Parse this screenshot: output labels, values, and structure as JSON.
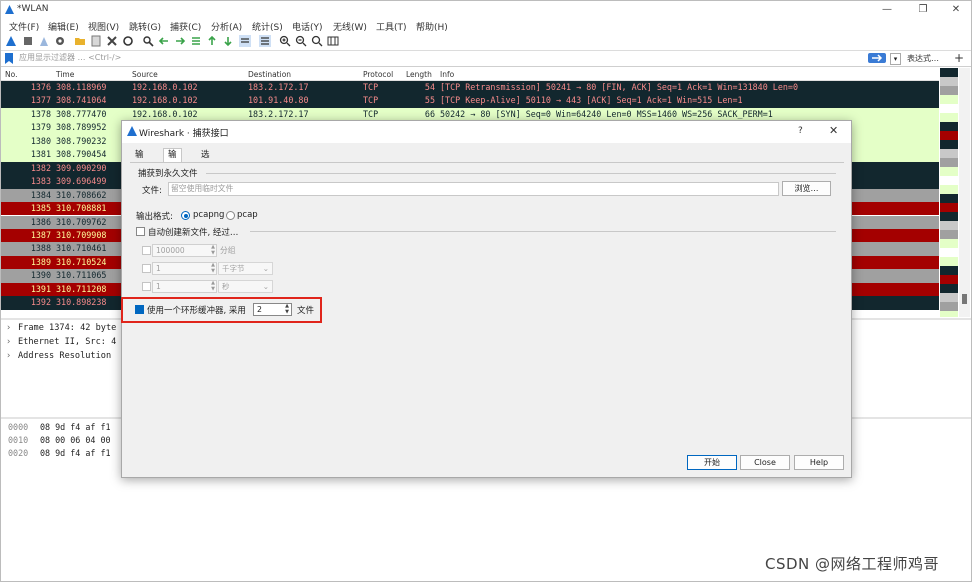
{
  "window": {
    "title": "*WLAN"
  },
  "menu": [
    "文件(F)",
    "编辑(E)",
    "视图(V)",
    "跳转(G)",
    "捕获(C)",
    "分析(A)",
    "统计(S)",
    "电话(Y)",
    "无线(W)",
    "工具(T)",
    "帮助(H)"
  ],
  "filter": {
    "placeholder": "应用显示过滤器 … <Ctrl-/>",
    "expression_label": "表达式…",
    "add_label": "+"
  },
  "packet_list": {
    "columns": [
      "No.",
      "Time",
      "Source",
      "Destination",
      "Protocol",
      "Length",
      "Info"
    ],
    "rows": [
      {
        "no": "1376",
        "time": "308.118969",
        "src": "192.168.0.102",
        "dst": "183.2.172.17",
        "proto": "TCP",
        "len": "54",
        "info": "[TCP Retransmission] 50241 → 80 [FIN, ACK] Seq=1 Ack=1 Win=131840 Len=0",
        "bg": "#12272e",
        "fg": "#f78b8b"
      },
      {
        "no": "1377",
        "time": "308.741064",
        "src": "192.168.0.102",
        "dst": "101.91.40.80",
        "proto": "TCP",
        "len": "55",
        "info": "[TCP Keep-Alive] 50110 → 443 [ACK] Seq=1 Ack=1 Win=515 Len=1",
        "bg": "#12272e",
        "fg": "#f78b8b"
      },
      {
        "no": "1378",
        "time": "308.777470",
        "src": "192.168.0.102",
        "dst": "183.2.172.17",
        "proto": "TCP",
        "len": "66",
        "info": "50242 → 80 [SYN] Seq=0 Win=64240 Len=0 MSS=1460 WS=256 SACK_PERM=1",
        "bg": "#e4ffc7",
        "fg": "#12272e"
      },
      {
        "no": "1379",
        "time": "308.789952",
        "src": "",
        "dst": "",
        "proto": "",
        "len": "",
        "info": "",
        "bg": "#e4ffc7",
        "fg": "#12272e"
      },
      {
        "no": "1380",
        "time": "308.790232",
        "src": "",
        "dst": "",
        "proto": "",
        "len": "",
        "info": "",
        "bg": "#e4ffc7",
        "fg": "#12272e"
      },
      {
        "no": "1381",
        "time": "308.790454",
        "src": "",
        "dst": "",
        "proto": "",
        "len": "",
        "info": "",
        "bg": "#e4ffc7",
        "fg": "#12272e"
      },
      {
        "no": "1382",
        "time": "309.090290",
        "src": "",
        "dst": "",
        "proto": "",
        "len": "",
        "info": "",
        "bg": "#12272e",
        "fg": "#f78b8b"
      },
      {
        "no": "1383",
        "time": "309.696499",
        "src": "",
        "dst": "",
        "proto": "",
        "len": "",
        "info": "",
        "bg": "#12272e",
        "fg": "#f78b8b"
      },
      {
        "no": "1384",
        "time": "310.708662",
        "src": "",
        "dst": "",
        "proto": "",
        "len": "",
        "info": "",
        "bg": "#a0a0a0",
        "fg": "#12272e"
      },
      {
        "no": "1385",
        "time": "310.708881",
        "src": "",
        "dst": "",
        "proto": "",
        "len": "",
        "info": "",
        "bg": "#a40000",
        "fg": "#fffc9c"
      },
      {
        "no": "1386",
        "time": "310.709762",
        "src": "",
        "dst": "",
        "proto": "",
        "len": "",
        "info": "",
        "bg": "#a0a0a0",
        "fg": "#12272e"
      },
      {
        "no": "1387",
        "time": "310.709908",
        "src": "",
        "dst": "",
        "proto": "",
        "len": "",
        "info": "",
        "bg": "#a40000",
        "fg": "#fffc9c"
      },
      {
        "no": "1388",
        "time": "310.710461",
        "src": "",
        "dst": "",
        "proto": "",
        "len": "",
        "info": "",
        "bg": "#a0a0a0",
        "fg": "#12272e"
      },
      {
        "no": "1389",
        "time": "310.710524",
        "src": "",
        "dst": "",
        "proto": "",
        "len": "",
        "info": "",
        "bg": "#a40000",
        "fg": "#fffc9c"
      },
      {
        "no": "1390",
        "time": "310.711065",
        "src": "",
        "dst": "",
        "proto": "",
        "len": "",
        "info": "",
        "bg": "#a0a0a0",
        "fg": "#12272e"
      },
      {
        "no": "1391",
        "time": "310.711208",
        "src": "",
        "dst": "",
        "proto": "",
        "len": "",
        "info": "",
        "bg": "#a40000",
        "fg": "#fffc9c"
      },
      {
        "no": "1392",
        "time": "310.898238",
        "src": "",
        "dst": "",
        "proto": "",
        "len": "",
        "info": "",
        "bg": "#12272e",
        "fg": "#f78b8b"
      }
    ]
  },
  "details": [
    "Frame 1374: 42 byte",
    "Ethernet II, Src: 4",
    "Address Resolution"
  ],
  "bytes": [
    {
      "offset": "0000",
      "hex": "08 9d f4 af f1"
    },
    {
      "offset": "0010",
      "hex": "08 00 06 04 00"
    },
    {
      "offset": "0020",
      "hex": "08 9d f4 af f1"
    }
  ],
  "dialog": {
    "title": "Wireshark · 捕获接口",
    "help": "?",
    "close": "✕",
    "tabs": [
      "输入",
      "输出",
      "选项"
    ],
    "active_tab": "输出",
    "capture_group_label": "捕获到永久文件",
    "file_label": "文件:",
    "file_placeholder": "留空使用临时文件",
    "browse_label": "浏览…",
    "output_format_label": "输出格式:",
    "format_options": [
      "pcapng",
      "pcap"
    ],
    "format_selected": "pcapng",
    "auto_new_file_label": "自动创建新文件, 经过…",
    "auto_rows": [
      {
        "value": "100000",
        "unit": "分组"
      },
      {
        "value": "1",
        "unit": "千字节"
      },
      {
        "value": "1",
        "unit": "秒"
      }
    ],
    "ring_buffer_label": "使用一个环形缓冲器, 采用",
    "ring_buffer_value": "2",
    "ring_buffer_unit": "文件",
    "ring_buffer_checked": true,
    "buttons": {
      "start": "开始",
      "close": "Close",
      "help": "Help"
    }
  },
  "watermark": "CSDN @网络工程师鸡哥"
}
